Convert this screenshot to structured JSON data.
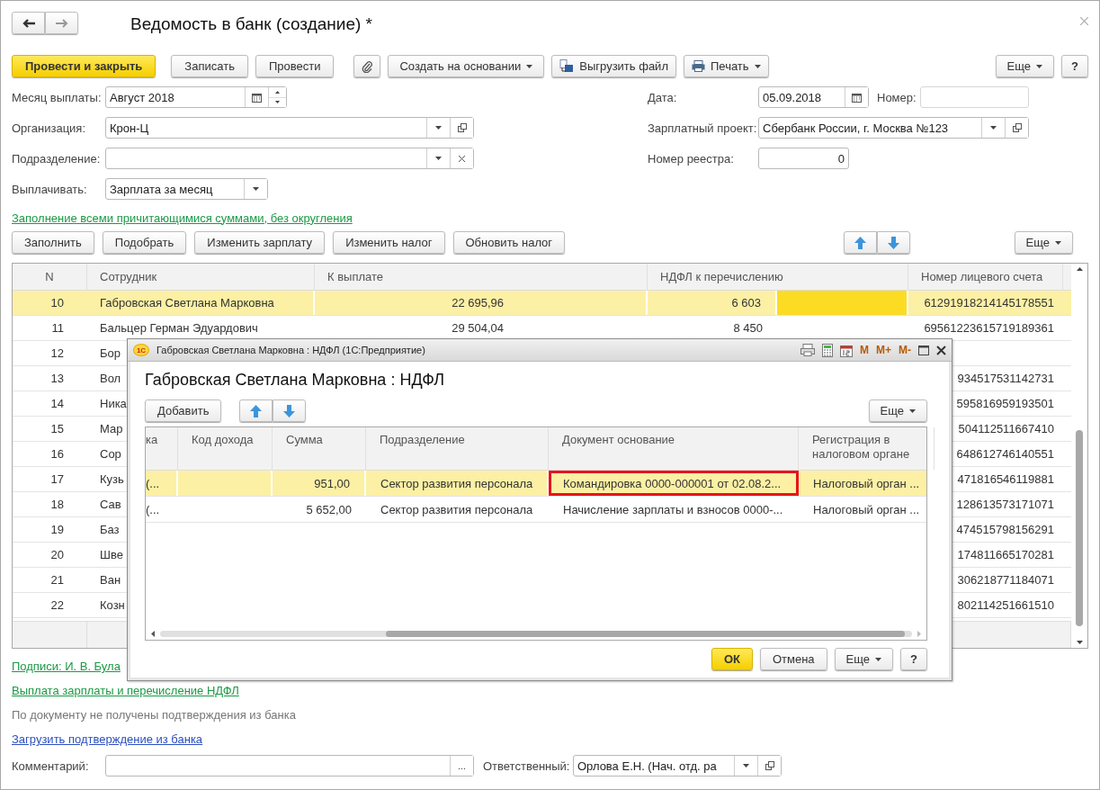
{
  "window": {
    "title": "Ведомость в банк (создание) *"
  },
  "toolbar": {
    "buttons": [
      {
        "label": "Провести и закрыть",
        "kind": "primary"
      },
      {
        "label": "Записать",
        "kind": "plain"
      },
      {
        "label": "Провести",
        "kind": "plain"
      },
      {
        "kind": "attach"
      },
      {
        "label": "Создать на основании",
        "kind": "menu"
      },
      {
        "label": "Выгрузить файл",
        "kind": "export"
      },
      {
        "label": "Печать",
        "kind": "print"
      }
    ],
    "more": "Еще",
    "help": "?"
  },
  "left_fields": [
    {
      "label": "Месяц выплаты:",
      "value": "Август 2018",
      "kind": "month"
    },
    {
      "label": "Организация:",
      "value": "Крон-Ц",
      "kind": "select-open"
    },
    {
      "label": "Подразделение:",
      "kind": "select-clear"
    },
    {
      "label": "Выплачивать:",
      "value": "Зарплата за месяц",
      "kind": "select"
    }
  ],
  "right_fields": [
    {
      "label": "Дата:",
      "value": "05.09.2018",
      "kind": "date",
      "extra_label": "Номер:"
    },
    {
      "label": "Зарплатный проект:",
      "value": "Сбербанк России, г. Москва №123",
      "kind": "select-open"
    },
    {
      "label": "Номер реестра:",
      "value": "0",
      "kind": "number"
    }
  ],
  "fill_link": "Заполнение всеми причитающимися суммами, без округления",
  "table_toolbar": {
    "buttons": [
      "Заполнить",
      "Подобрать",
      "Изменить зарплату",
      "Изменить налог",
      "Обновить налог"
    ],
    "more": "Еще"
  },
  "table": {
    "columns": [
      "N",
      "Сотрудник",
      "К выплате",
      "НДФЛ к перечислению",
      "Номер лицевого счета"
    ],
    "rows": [
      {
        "n": "10",
        "employee": "Габровская Светлана Марковна",
        "to_pay": "22 695,96",
        "tax": "6 603",
        "account": "61291918214145178551",
        "selected": true
      },
      {
        "n": "11",
        "employee": "Бальцер Герман Эдуардович",
        "to_pay": "29 504,04",
        "tax": "8 450",
        "account": "69561223615719189361",
        "selected": false
      },
      {
        "n": "12",
        "employee": "Бор",
        "selected": false
      },
      {
        "n": "13",
        "employee": "Вол",
        "account": "934517531142731",
        "selected": false
      },
      {
        "n": "14",
        "employee": "Ника",
        "account": "595816959193501",
        "selected": false
      },
      {
        "n": "15",
        "employee": "Мар",
        "account": "504112511667410",
        "selected": false
      },
      {
        "n": "16",
        "employee": "Сор",
        "account": "648612746140551",
        "selected": false
      },
      {
        "n": "17",
        "employee": "Кузь",
        "account": "471816546119881",
        "selected": false
      },
      {
        "n": "18",
        "employee": "Сав",
        "account": "128613573171071",
        "selected": false
      },
      {
        "n": "19",
        "employee": "Баз",
        "account": "474515798156291",
        "selected": false
      },
      {
        "n": "20",
        "employee": "Шве",
        "account": "174811665170281",
        "selected": false
      },
      {
        "n": "21",
        "employee": "Ван",
        "account": "306218771184071",
        "selected": false
      },
      {
        "n": "22",
        "employee": "Козн",
        "account": "802114251661510",
        "selected": false
      }
    ]
  },
  "signatures_link": "Подписи: И. В. Була",
  "payment_link": "Выплата зарплаты и перечисление НДФЛ",
  "bank_status": "По документу не получены подтверждения из банка",
  "load_link": "Загрузить подтверждение из банка",
  "comment": {
    "label": "Комментарий:",
    "button": "..."
  },
  "responsible": {
    "label": "Ответственный:",
    "value": "Орлова Е.Н. (Нач. отд. ра"
  },
  "dialog": {
    "title": "Габровская Светлана Марковна : НДФЛ  (1С:Предприятие)",
    "logo": "1С",
    "tools": [
      {
        "kind": "print"
      },
      {
        "kind": "calculator"
      },
      {
        "kind": "calendar"
      },
      {
        "kind": "text",
        "label": "M"
      },
      {
        "kind": "text",
        "label": "M+"
      },
      {
        "kind": "text",
        "label": "M-"
      },
      {
        "kind": "maximize"
      },
      {
        "kind": "close"
      }
    ],
    "heading": "Габровская Светлана Марковна : НДФЛ",
    "add": "Добавить",
    "more": "Еще",
    "table": {
      "columns": [
        "ка",
        "Код дохода",
        "Сумма",
        "Подразделение",
        "Документ основание",
        "Регистрация в налоговом органе"
      ],
      "rows": [
        {
          "column_1": "(...",
          "amount": "951,00",
          "department": "Сектор развития персонала",
          "document": "Командировка 0000-000001 от 02.08.2...",
          "registration": "Налоговый орган ...",
          "selected": true,
          "document_highlighted": true
        },
        {
          "column_1": "(...",
          "amount": "5 652,00",
          "department": "Сектор развития персонала",
          "document": "Начисление зарплаты и взносов 0000-...",
          "registration": "Налоговый орган ...",
          "selected": false,
          "document_highlighted": false
        }
      ]
    },
    "ok": "ОК",
    "cancel": "Отмена",
    "dialog_more": "Еще",
    "help": "?"
  }
}
